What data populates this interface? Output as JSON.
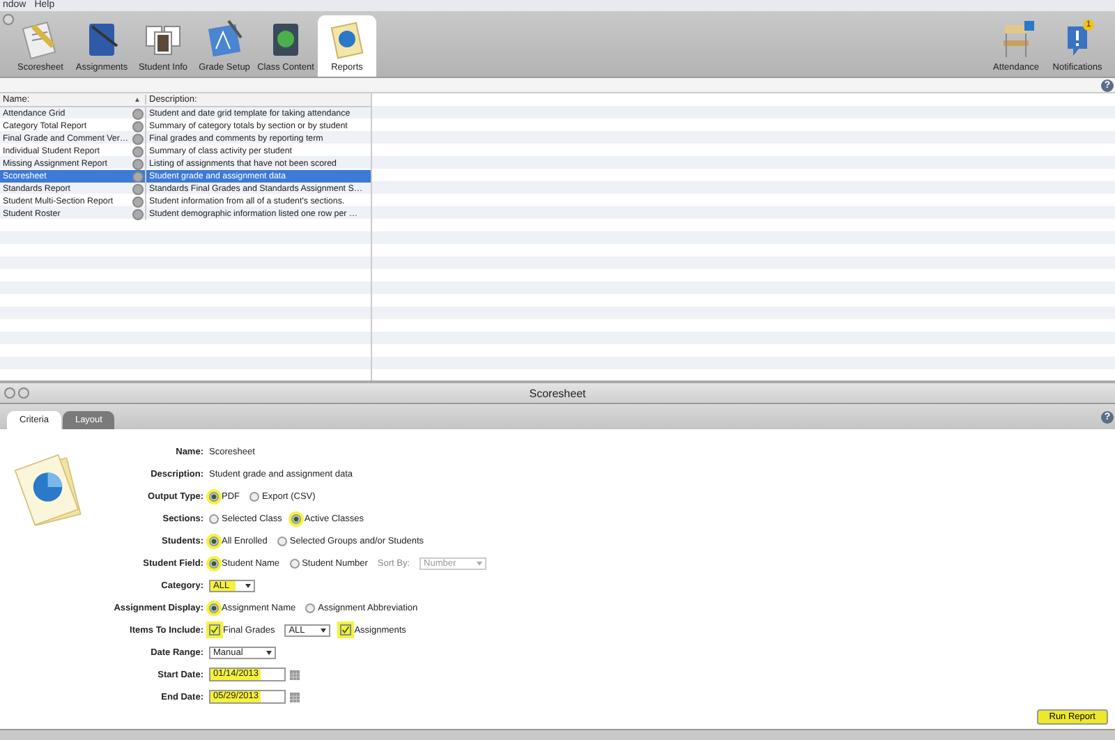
{
  "menu": [
    "ndow",
    "Help"
  ],
  "toolbar": {
    "items": [
      {
        "label": "Scoresheet",
        "kind": "scoresheet",
        "selected": false
      },
      {
        "label": "Assignments",
        "kind": "assignments",
        "selected": false
      },
      {
        "label": "Student Info",
        "kind": "students",
        "selected": false
      },
      {
        "label": "Grade Setup",
        "kind": "grade",
        "selected": false
      },
      {
        "label": "Class Content",
        "kind": "content",
        "selected": false
      },
      {
        "label": "Reports",
        "kind": "reports",
        "selected": true
      }
    ],
    "right_items": [
      {
        "label": "Attendance",
        "kind": "attendance"
      },
      {
        "label": "Notifications",
        "kind": "notifications",
        "badge": "1"
      }
    ]
  },
  "help_top": "?",
  "reports_table": {
    "columns": [
      {
        "label": "Name:",
        "sort": "▲"
      },
      {
        "label": "Description:"
      }
    ],
    "rows": [
      {
        "name": "Attendance Grid",
        "description": "Student and date grid template for taking attendance",
        "selected": false
      },
      {
        "name": "Category Total Report",
        "description": "Summary of category totals by section or by student",
        "selected": false
      },
      {
        "name": "Final Grade and Comment Ver…",
        "description": "Final grades and comments by reporting term",
        "selected": false
      },
      {
        "name": "Individual Student Report",
        "description": "Summary of class activity per student",
        "selected": false
      },
      {
        "name": "Missing Assignment Report",
        "description": "Listing of assignments that have not been scored",
        "selected": false
      },
      {
        "name": "Scoresheet",
        "description": "Student grade and assignment data",
        "selected": true
      },
      {
        "name": "Standards Report",
        "description": "Standards Final Grades and Standards Assignment S…",
        "selected": false
      },
      {
        "name": "Student Multi-Section Report",
        "description": "Student information from all of a student's sections.",
        "selected": false
      },
      {
        "name": "Student Roster",
        "description": "Student demographic information listed one row per …",
        "selected": false
      }
    ]
  },
  "panel": {
    "title": "Scoresheet",
    "help": "?",
    "tabs": [
      {
        "label": "Criteria",
        "selected": true
      },
      {
        "label": "Layout",
        "selected": false
      }
    ],
    "form": [
      {
        "label": "Name:",
        "controls": [
          {
            "kind": "text",
            "label": "Scoresheet"
          }
        ]
      },
      {
        "label": "Description:",
        "controls": [
          {
            "kind": "text",
            "label": "Student grade and assignment data"
          }
        ]
      },
      {
        "label": "Output Type:",
        "controls": [
          {
            "kind": "radio",
            "label": "PDF",
            "selected": true,
            "highlighted": true
          },
          {
            "kind": "radio",
            "label": "Export (CSV)",
            "selected": false,
            "highlighted": false
          }
        ]
      },
      {
        "label": "Sections:",
        "controls": [
          {
            "kind": "radio",
            "label": "Selected Class",
            "selected": false,
            "highlighted": false
          },
          {
            "kind": "radio",
            "label": "Active Classes",
            "selected": true,
            "highlighted": true
          }
        ]
      },
      {
        "label": "Students:",
        "controls": [
          {
            "kind": "radio",
            "label": "All Enrolled",
            "selected": true,
            "highlighted": true
          },
          {
            "kind": "radio",
            "label": "Selected Groups and/or Students",
            "selected": false,
            "highlighted": false
          }
        ]
      },
      {
        "label": "Student Field:",
        "controls": [
          {
            "kind": "radio",
            "label": "Student Name",
            "selected": true,
            "highlighted": true
          },
          {
            "kind": "radio",
            "label": "Student Number",
            "selected": false,
            "highlighted": false
          },
          {
            "kind": "caption",
            "label": "Sort By:"
          },
          {
            "kind": "select",
            "label": "Number",
            "disabled": true,
            "highlighted": false
          }
        ]
      },
      {
        "label": "Category:",
        "controls": [
          {
            "kind": "select",
            "label": "ALL",
            "disabled": false,
            "highlighted": true
          }
        ]
      },
      {
        "label": "Assignment Display:",
        "controls": [
          {
            "kind": "radio",
            "label": "Assignment Name",
            "selected": true,
            "highlighted": true
          },
          {
            "kind": "radio",
            "label": "Assignment Abbreviation",
            "selected": false,
            "highlighted": false
          }
        ]
      },
      {
        "label": "Items To Include:",
        "controls": [
          {
            "kind": "check",
            "label": "Final Grades",
            "checked": true,
            "highlighted": true
          },
          {
            "kind": "select",
            "label": "ALL",
            "disabled": false,
            "highlighted": false
          },
          {
            "kind": "check",
            "label": "Assignments",
            "checked": true,
            "highlighted": true
          }
        ]
      },
      {
        "label": "Date Range:",
        "controls": [
          {
            "kind": "select",
            "label": "Manual",
            "disabled": false,
            "highlighted": false
          }
        ]
      },
      {
        "label": "Start Date:",
        "controls": [
          {
            "kind": "date",
            "label": "01/14/2013",
            "highlighted": true
          }
        ]
      },
      {
        "label": "End Date:",
        "controls": [
          {
            "kind": "date",
            "label": "05/29/2013",
            "highlighted": true
          }
        ]
      }
    ],
    "run_button": {
      "label": "Run Report",
      "highlighted": true
    }
  }
}
